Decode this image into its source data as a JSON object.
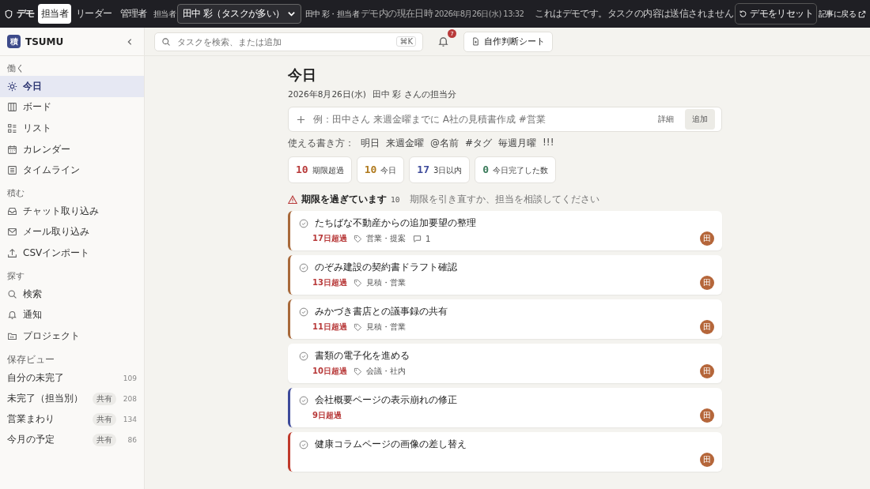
{
  "topbar": {
    "demo_badge": "デモ",
    "roles": [
      {
        "label": "担当者",
        "selected": true
      },
      {
        "label": "リーダー",
        "selected": false
      },
      {
        "label": "管理者",
        "selected": false
      }
    ],
    "user_label": "担当者",
    "user_select": "田中 彩（タスクが多い）",
    "user_info": "田中 彩・担当者",
    "clock_label": "デモ内の現在日時",
    "clock_value": "2026年8月26日(水) 13:32",
    "notice": "これはデモです。タスクの内容は送信されません",
    "reset_button": "デモをリセット",
    "back_link": "記事に戻る"
  },
  "sidebar": {
    "logo_mark": "積",
    "app_name": "TSUMU",
    "groups": [
      {
        "label": "働く",
        "items": [
          {
            "label": "今日",
            "selected": true
          },
          {
            "label": "ボード",
            "selected": false
          },
          {
            "label": "リスト",
            "selected": false
          },
          {
            "label": "カレンダー",
            "selected": false
          },
          {
            "label": "タイムライン",
            "selected": false
          }
        ]
      },
      {
        "label": "積む",
        "items": [
          {
            "label": "チャット取り込み",
            "selected": false
          },
          {
            "label": "メール取り込み",
            "selected": false
          },
          {
            "label": "CSVインポート",
            "selected": false
          }
        ]
      },
      {
        "label": "探す",
        "items": [
          {
            "label": "検索",
            "selected": false
          },
          {
            "label": "通知",
            "selected": false
          },
          {
            "label": "プロジェクト",
            "selected": false
          }
        ]
      }
    ],
    "saved_label": "保存ビュー",
    "saved_views": [
      {
        "label": "自分の未完了",
        "count": "109"
      },
      {
        "label": "未完了（担当別）",
        "shared": "共有",
        "count": "208"
      },
      {
        "label": "営業まわり",
        "shared": "共有",
        "count": "134"
      },
      {
        "label": "今月の予定",
        "shared": "共有",
        "count": "86"
      }
    ]
  },
  "header": {
    "search_placeholder": "タスクを検索、または追加",
    "shortcut": "⌘K",
    "notification_count": "7",
    "sheet_button": "自作判断シート"
  },
  "page": {
    "title": "今日",
    "date": "2026年8月26日(水)",
    "owner": "田中 彩 さんの担当分",
    "quick_add": {
      "placeholder": "例：田中さん 来週金曜までに A社の見積書作成 #営業",
      "detail": "詳細",
      "add_button": "追加"
    },
    "hints_label": "使える書き方：",
    "hints": [
      "明日",
      "来週金曜",
      "@名前",
      "#タグ",
      "毎週月曜",
      "!!!"
    ],
    "stats": [
      {
        "value": "10",
        "label": "期限超過",
        "color": "#b83a3a"
      },
      {
        "value": "10",
        "label": "今日",
        "color": "#b07a1e"
      },
      {
        "value": "17",
        "label": "3日以内",
        "color": "#3d4a9a"
      },
      {
        "value": "0",
        "label": "今日完了した数",
        "color": "#3a7a5a"
      }
    ],
    "section": {
      "title": "期限を過ぎています",
      "count": "10",
      "note": "期限を引き直すか、担当を相談してください"
    },
    "tasks": [
      {
        "title": "たちばな不動産からの追加要望の整理",
        "overdue": "17日超過",
        "tag": "営業・提案",
        "comments": "1",
        "avatar": "田",
        "color": "#a8693a"
      },
      {
        "title": "のぞみ建設の契約書ドラフト確認",
        "overdue": "13日超過",
        "tag": "見積・営業",
        "avatar": "田",
        "color": "#a8693a"
      },
      {
        "title": "みかづき書店との議事録の共有",
        "overdue": "11日超過",
        "tag": "見積・営業",
        "avatar": "田",
        "color": "#a8693a"
      },
      {
        "title": "書類の電子化を進める",
        "overdue": "10日超過",
        "tag": "会議・社内",
        "avatar": "田"
      },
      {
        "title": "会社概要ページの表示崩れの修正",
        "overdue": "9日超過",
        "avatar": "田",
        "color": "#3d4a9a"
      },
      {
        "title": "健康コラムページの画像の差し替え",
        "avatar": "田",
        "color": "#c0392b"
      }
    ]
  }
}
